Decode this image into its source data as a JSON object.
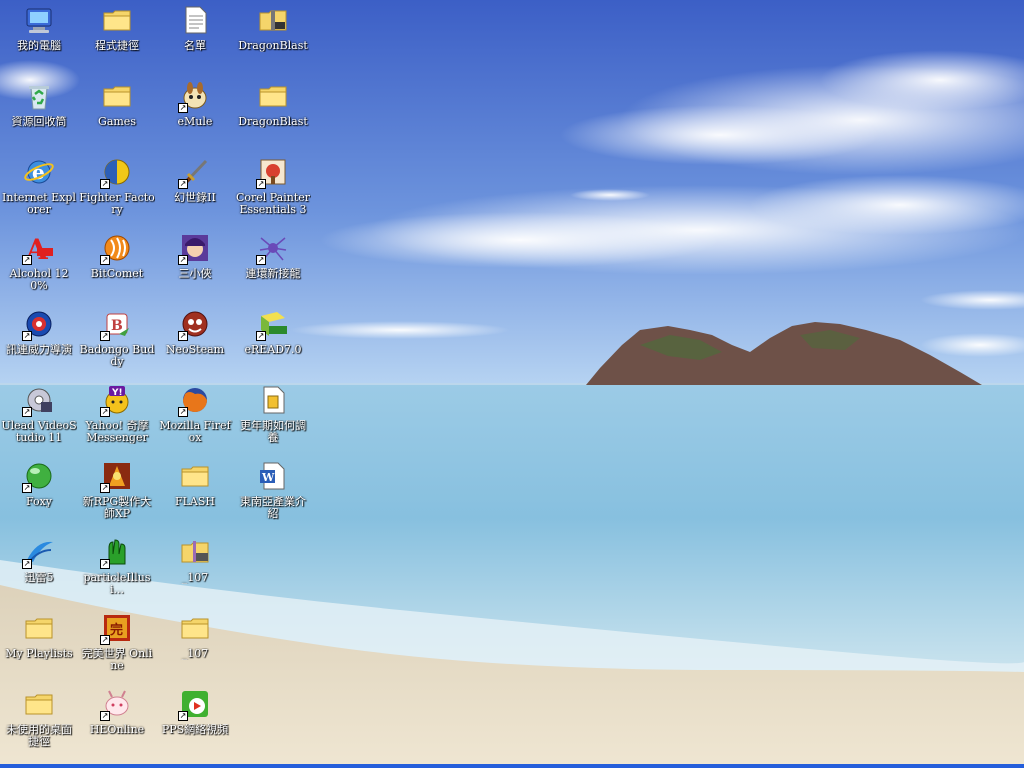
{
  "desktop": {
    "icons": [
      {
        "label": "我的電腦",
        "icon": "my-computer-icon",
        "shortcut": false
      },
      {
        "label": "程式捷徑",
        "icon": "folder-icon",
        "shortcut": false
      },
      {
        "label": "名單",
        "icon": "text-document-icon",
        "shortcut": false
      },
      {
        "label": "DragonBlast",
        "icon": "zip-folder-icon",
        "shortcut": false
      },
      {
        "label": "資源回收筒",
        "icon": "recycle-bin-icon",
        "shortcut": false
      },
      {
        "label": "Games",
        "icon": "folder-icon",
        "shortcut": false
      },
      {
        "label": "eMule",
        "icon": "emule-icon",
        "shortcut": true
      },
      {
        "label": "DragonBlast",
        "icon": "folder-icon",
        "shortcut": false
      },
      {
        "label": "Internet Explorer",
        "icon": "internet-explorer-icon",
        "shortcut": false
      },
      {
        "label": "Fighter Factory",
        "icon": "fighter-factory-icon",
        "shortcut": true
      },
      {
        "label": "幻世錄II",
        "icon": "sword-icon",
        "shortcut": true
      },
      {
        "label": "Corel Painter Essentials 3",
        "icon": "corel-painter-icon",
        "shortcut": true
      },
      {
        "label": "Alcohol 120%",
        "icon": "alcohol-120-icon",
        "shortcut": true
      },
      {
        "label": "BitComet",
        "icon": "bitcomet-icon",
        "shortcut": true
      },
      {
        "label": "三小俠",
        "icon": "game-character-icon",
        "shortcut": true
      },
      {
        "label": "連環新接龍",
        "icon": "spider-icon",
        "shortcut": true
      },
      {
        "label": "訊連威力導演",
        "icon": "powerdirector-icon",
        "shortcut": true
      },
      {
        "label": "Badongo Buddy",
        "icon": "badongo-buddy-icon",
        "shortcut": true
      },
      {
        "label": "NeoSteam",
        "icon": "neosteam-icon",
        "shortcut": true
      },
      {
        "label": "eREAD7.0",
        "icon": "eread-icon",
        "shortcut": true
      },
      {
        "label": "Ulead VideoStudio 11",
        "icon": "ulead-videostudio-icon",
        "shortcut": true
      },
      {
        "label": "Yahoo! 奇摩 Messenger",
        "icon": "yahoo-messenger-icon",
        "shortcut": true
      },
      {
        "label": "Mozilla Firefox",
        "icon": "firefox-icon",
        "shortcut": true
      },
      {
        "label": "更年期如何調養",
        "icon": "file-icon",
        "shortcut": false
      },
      {
        "label": "Foxy",
        "icon": "foxy-icon",
        "shortcut": true
      },
      {
        "label": "新RPG製作大師XP",
        "icon": "rpg-maker-icon",
        "shortcut": true
      },
      {
        "label": "FLASH",
        "icon": "folder-icon",
        "shortcut": false
      },
      {
        "label": "東南亞產業介紹",
        "icon": "word-document-icon",
        "shortcut": false
      },
      {
        "label": "迅雷5",
        "icon": "thunder-icon",
        "shortcut": true
      },
      {
        "label": "particleIllusi...",
        "icon": "particle-illusion-icon",
        "shortcut": true
      },
      {
        "label": "_107",
        "icon": "rar-archive-icon",
        "shortcut": false
      },
      null,
      {
        "label": "My Playlists",
        "icon": "folder-icon",
        "shortcut": false
      },
      {
        "label": "完美世界 Online",
        "icon": "perfect-world-icon",
        "shortcut": true
      },
      {
        "label": "_107",
        "icon": "folder-icon",
        "shortcut": false
      },
      null,
      {
        "label": "未使用的桌面捷徑",
        "icon": "folder-icon",
        "shortcut": false
      },
      {
        "label": "HEOnline",
        "icon": "heonline-icon",
        "shortcut": true
      },
      {
        "label": "PPS網絡視頻",
        "icon": "pps-icon",
        "shortcut": true
      },
      null
    ]
  },
  "wallpaper": {
    "sky_top": "#3f63c7",
    "sky_bottom": "#a9c8ee",
    "sea": "#8fc4e0",
    "sand": "#e8dcc0"
  }
}
